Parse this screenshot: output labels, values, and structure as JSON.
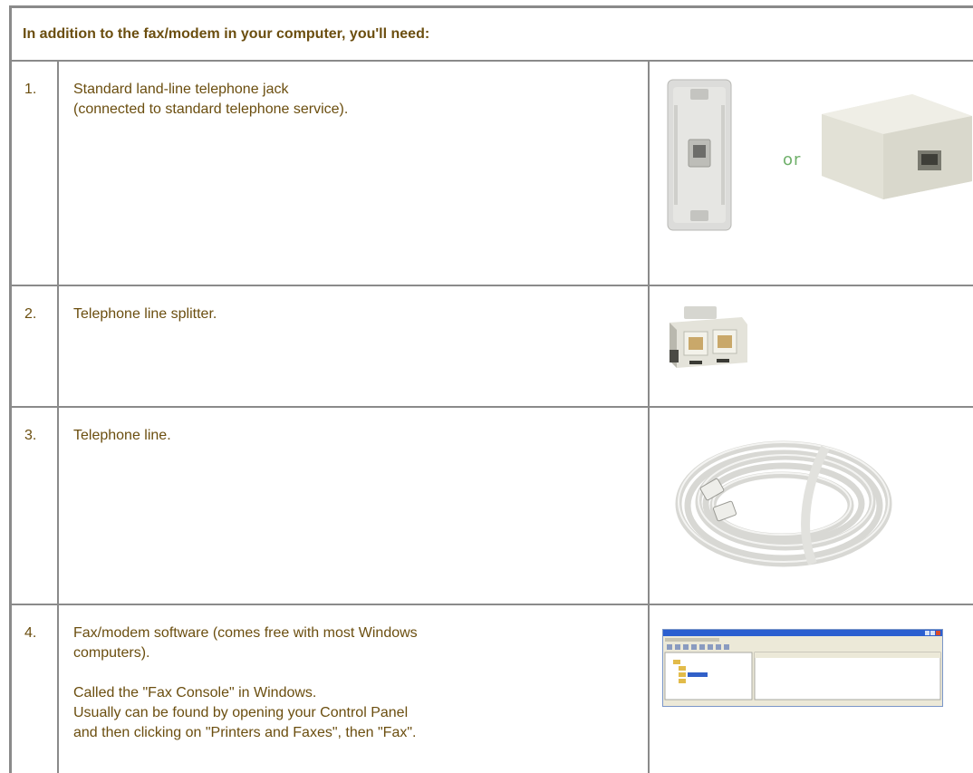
{
  "header": {
    "title": "In addition to the fax/modem in your computer, you'll need:"
  },
  "items": [
    {
      "number": "1.",
      "lines": [
        "Standard land-line telephone jack",
        "(connected to standard telephone service)."
      ],
      "image": "wall-jack-or-surface-jack",
      "or_label": "or"
    },
    {
      "number": "2.",
      "lines": [
        "Telephone line splitter."
      ],
      "image": "line-splitter"
    },
    {
      "number": "3.",
      "lines": [
        "Telephone line."
      ],
      "image": "coiled-telephone-cord"
    },
    {
      "number": "4.",
      "lines": [
        "Fax/modem software (comes free with most Windows",
        "computers)."
      ],
      "lines2": [
        "Called the \"Fax Console\" in Windows.",
        "Usually can be found by opening your Control Panel",
        "and then clicking on \"Printers and Faxes\", then \"Fax\"."
      ],
      "image": "fax-console-screenshot"
    }
  ],
  "colors": {
    "text": "#6b4e0f",
    "border": "#8a8a8a",
    "or_label": "#6fb06a"
  }
}
